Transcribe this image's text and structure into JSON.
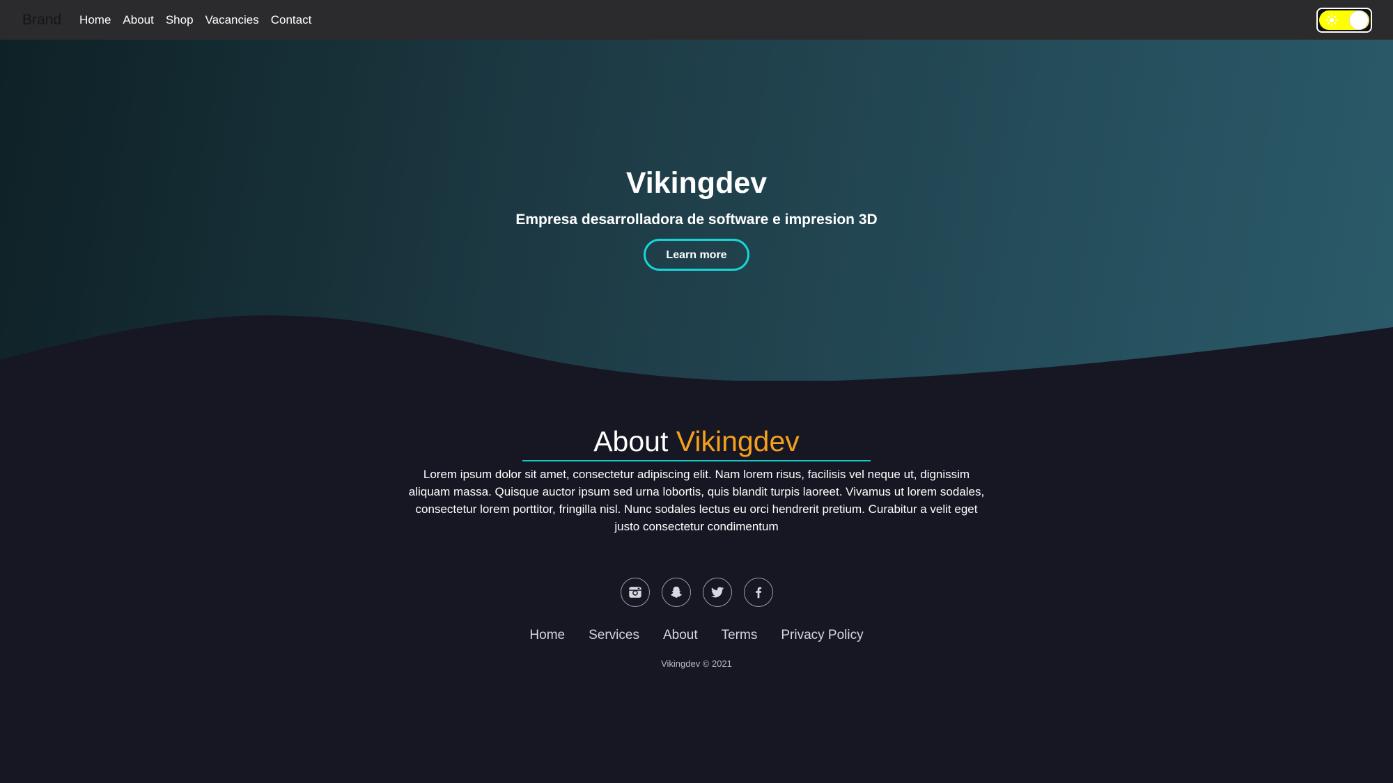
{
  "navbar": {
    "brand": "Brand",
    "links": [
      "Home",
      "About",
      "Shop",
      "Vacancies",
      "Contact"
    ],
    "theme_toggle": "light"
  },
  "hero": {
    "title": "Vikingdev",
    "subtitle": "Empresa desarrolladora de software e impresion 3D",
    "button_label": "Learn more"
  },
  "about": {
    "heading_prefix": "About",
    "heading_accent": "Vikingdev",
    "text": "Lorem ipsum dolor sit amet, consectetur adipiscing elit. Nam lorem risus, facilisis vel neque ut, dignissim aliquam massa. Quisque auctor ipsum sed urna lobortis, quis blandit turpis laoreet. Vivamus ut lorem sodales, consectetur lorem porttitor, fringilla nisl. Nunc sodales lectus eu orci hendrerit pretium. Curabitur a velit eget justo consectetur condimentum"
  },
  "social": [
    "instagram-icon",
    "snapchat-icon",
    "twitter-icon",
    "facebook-icon"
  ],
  "footer": {
    "links": [
      "Home",
      "Services",
      "About",
      "Terms",
      "Privacy Policy"
    ],
    "copyright": "Vikingdev © 2021"
  },
  "colors": {
    "accent_orange": "#f4a01c",
    "accent_cyan": "#18d6d6",
    "toggle_yellow": "#ffff00",
    "page_background": "#171723"
  }
}
